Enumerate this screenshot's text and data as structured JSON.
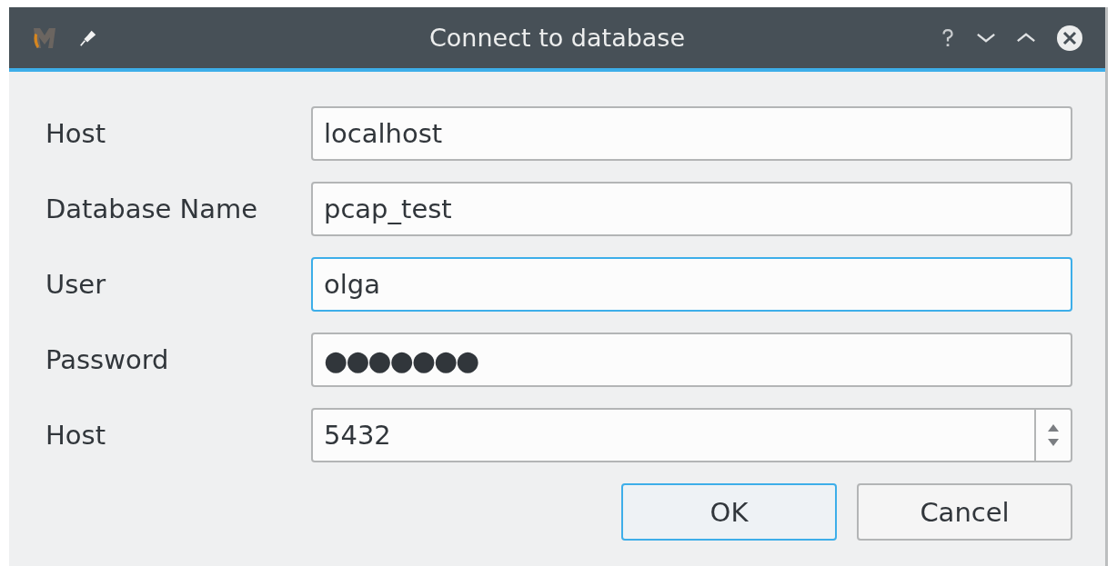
{
  "window": {
    "title": "Connect to database"
  },
  "fields": [
    {
      "label": "Host",
      "value": "localhost",
      "kind": "text",
      "focused": false
    },
    {
      "label": "Database Name",
      "value": "pcap_test",
      "kind": "text",
      "focused": false
    },
    {
      "label": "User",
      "value": "olga",
      "kind": "text",
      "focused": true
    },
    {
      "label": "Password",
      "value": "●●●●●●●",
      "kind": "password",
      "focused": false
    },
    {
      "label": "Host",
      "value": "5432",
      "kind": "spin",
      "focused": false
    }
  ],
  "buttons": [
    {
      "label": "OK",
      "default": true
    },
    {
      "label": "Cancel",
      "default": false
    }
  ]
}
